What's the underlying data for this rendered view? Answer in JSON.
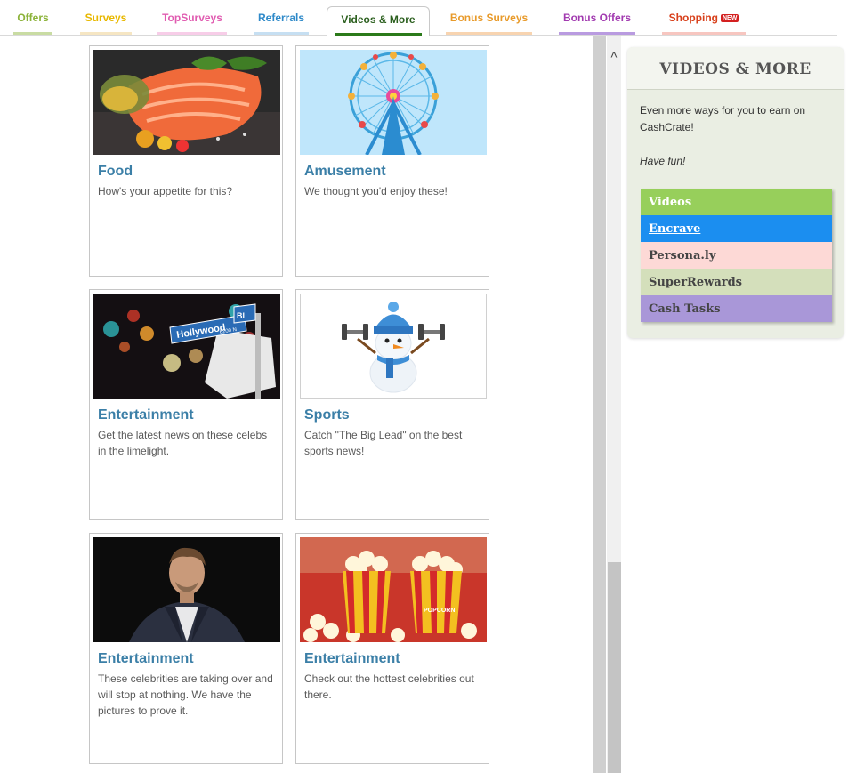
{
  "tabs": [
    {
      "label": "Offers",
      "color": "#8cb33a",
      "bar": "#c9dca3"
    },
    {
      "label": "Surveys",
      "color": "#e8b800",
      "bar": "#f6e6c3"
    },
    {
      "label": "TopSurveys",
      "color": "#e05bb0",
      "bar": "#f7cde8"
    },
    {
      "label": "Referrals",
      "color": "#2f8ac9",
      "bar": "#c6dff2"
    },
    {
      "label": "Videos & More",
      "color": "#2b5f1e",
      "bar": "#2b7a1a"
    },
    {
      "label": "Bonus Surveys",
      "color": "#e89a2a",
      "bar": "#f8d4b0"
    },
    {
      "label": "Bonus Offers",
      "color": "#a23bb0",
      "bar": "#b99be0"
    },
    {
      "label": "Shopping",
      "color": "#d8401b",
      "bar": "#f7c6c0",
      "badge": "NEW"
    }
  ],
  "cards": [
    {
      "title": "Food",
      "desc": "How's your appetite for this?",
      "image": "salmon-dish"
    },
    {
      "title": "Amusement",
      "desc": "We thought you'd enjoy these!",
      "image": "ferris-wheel"
    },
    {
      "title": "Entertainment",
      "desc": "Get the latest news on these celebs in the limelight.",
      "image": "hollywood-sign",
      "sign_text": "Hollywood",
      "sign_num": "6200 N",
      "sign_bl": "Bl"
    },
    {
      "title": "Sports",
      "desc": "Catch \"The Big Lead\" on the best sports news!",
      "image": "snowman-dumbbells"
    },
    {
      "title": "Entertainment",
      "desc": "These celebrities are taking over and will stop at nothing. We have the pictures to prove it.",
      "image": "celebrity-portrait"
    },
    {
      "title": "Entertainment",
      "desc": "Check out the hottest celebrities out there.",
      "image": "popcorn",
      "popcorn_text": "POPCORN"
    }
  ],
  "sidebar": {
    "title": "VIDEOS & MORE",
    "intro": "Even more ways for you to earn on CashCrate!",
    "fun": "Have fun!",
    "menu": [
      {
        "label": "Videos",
        "bg": "#97cf5b",
        "color": "#ffffff"
      },
      {
        "label": "Encrave",
        "bg": "#1b8ef0",
        "color": "#ffffff"
      },
      {
        "label": "Persona.ly",
        "bg": "#fdd9d6",
        "color": "#444444"
      },
      {
        "label": "SuperRewards",
        "bg": "#d4dfbb",
        "color": "#444444"
      },
      {
        "label": "Cash Tasks",
        "bg": "#a997d8",
        "color": "#444444"
      }
    ]
  },
  "scrollbar": {
    "up_arrow": "˄"
  }
}
